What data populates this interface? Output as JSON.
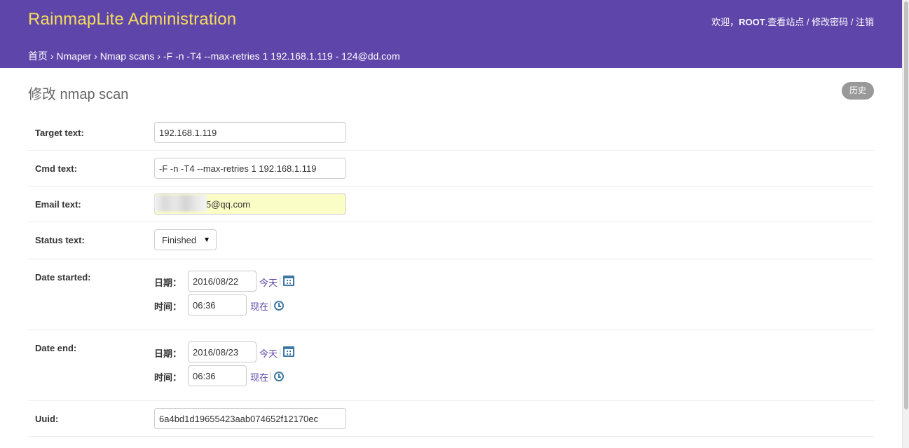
{
  "header": {
    "branding": "RainmapLite Administration",
    "user_tools": {
      "welcome": "欢迎，",
      "username": "ROOT",
      "separator_after_user": ".",
      "view_site": "查看站点",
      "sep1": " / ",
      "change_password": "修改密码",
      "sep2": " / ",
      "logout": "注销"
    }
  },
  "breadcrumbs": {
    "home": "首页",
    "arrow": " › ",
    "app": "Nmaper",
    "model": "Nmap scans",
    "current": "-F -n -T4 --max-retries 1 192.168.1.119 - 124@dd.com"
  },
  "page": {
    "title": "修改 nmap scan",
    "history_button": "历史"
  },
  "form": {
    "target": {
      "label": "Target text:",
      "value": "192.168.1.119"
    },
    "cmd": {
      "label": "Cmd text:",
      "value": "-F -n -T4 --max-retries 1 192.168.1.119"
    },
    "email": {
      "label": "Email text:",
      "value": "5@qq.com"
    },
    "status": {
      "label": "Status text:",
      "selected": "Finished",
      "arrow": "▼"
    },
    "date_started": {
      "label": "Date started:",
      "date_label": "日期：",
      "date_value": "2016/08/22",
      "today_link": "今天",
      "time_label": "时间：",
      "time_value": "06:36",
      "now_link": "现在",
      "pipe": "|"
    },
    "date_end": {
      "label": "Date end:",
      "date_label": "日期：",
      "date_value": "2016/08/23",
      "today_link": "今天",
      "time_label": "时间：",
      "time_value": "06:36",
      "now_link": "现在",
      "pipe": "|"
    },
    "uuid": {
      "label": "Uuid:",
      "value": "6a4bd1d19655423aab074652f12170ec"
    }
  },
  "colors": {
    "header_bg": "#5e45a9",
    "branding": "#f5dd5d",
    "link": "#5e45a9",
    "icon": "#3f79a3",
    "autofill_bg": "#fafdc5"
  }
}
